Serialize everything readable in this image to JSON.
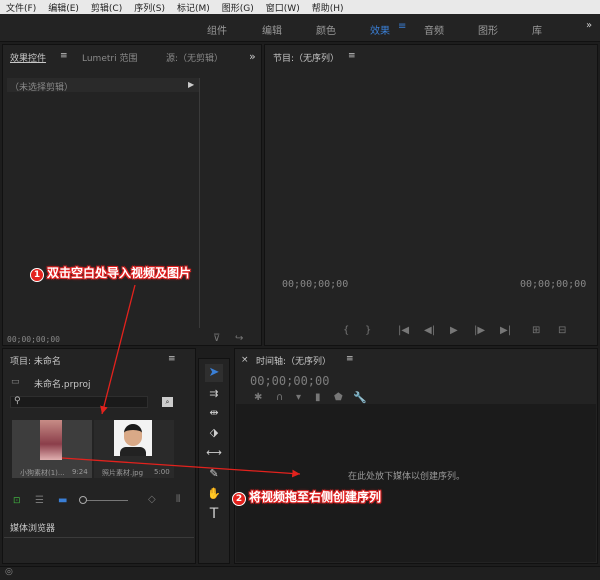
{
  "menu": [
    "文件(F)",
    "编辑(E)",
    "剪辑(C)",
    "序列(S)",
    "标记(M)",
    "图形(G)",
    "窗口(W)",
    "帮助(H)"
  ],
  "workspaces": [
    "组件",
    "编辑",
    "颜色",
    "效果",
    "音频",
    "图形",
    "库"
  ],
  "active_workspace": "效果",
  "source_panel": {
    "tabs": [
      "效果控件",
      "Lumetri 范围",
      "源:（无剪辑）"
    ],
    "no_clip": "（未选择剪辑）",
    "timecode": "00;00;00;00"
  },
  "program_panel": {
    "title": "节目:（无序列）",
    "tc_left": "00;00;00;00",
    "tc_right": "00;00;00;00"
  },
  "project_panel": {
    "title": "项目: 未命名",
    "file": "未命名.prproj",
    "items": [
      {
        "name": "小狗素材(1)...",
        "duration": "9:24"
      },
      {
        "name": "照片素材.jpg",
        "duration": "5:00"
      }
    ],
    "media_browser": "媒体浏览器"
  },
  "timeline_panel": {
    "title": "时间轴:（无序列）",
    "timecode": "00;00;00;00",
    "drop_hint": "在此处放下媒体以创建序列。"
  },
  "annotations": {
    "step1_num": "1",
    "step1": "双击空白处导入视频及图片",
    "step2_num": "2",
    "step2": "将视频拖至右侧创建序列"
  },
  "colors": {
    "accent": "#3a7fd6",
    "annotation": "#e3221d"
  }
}
